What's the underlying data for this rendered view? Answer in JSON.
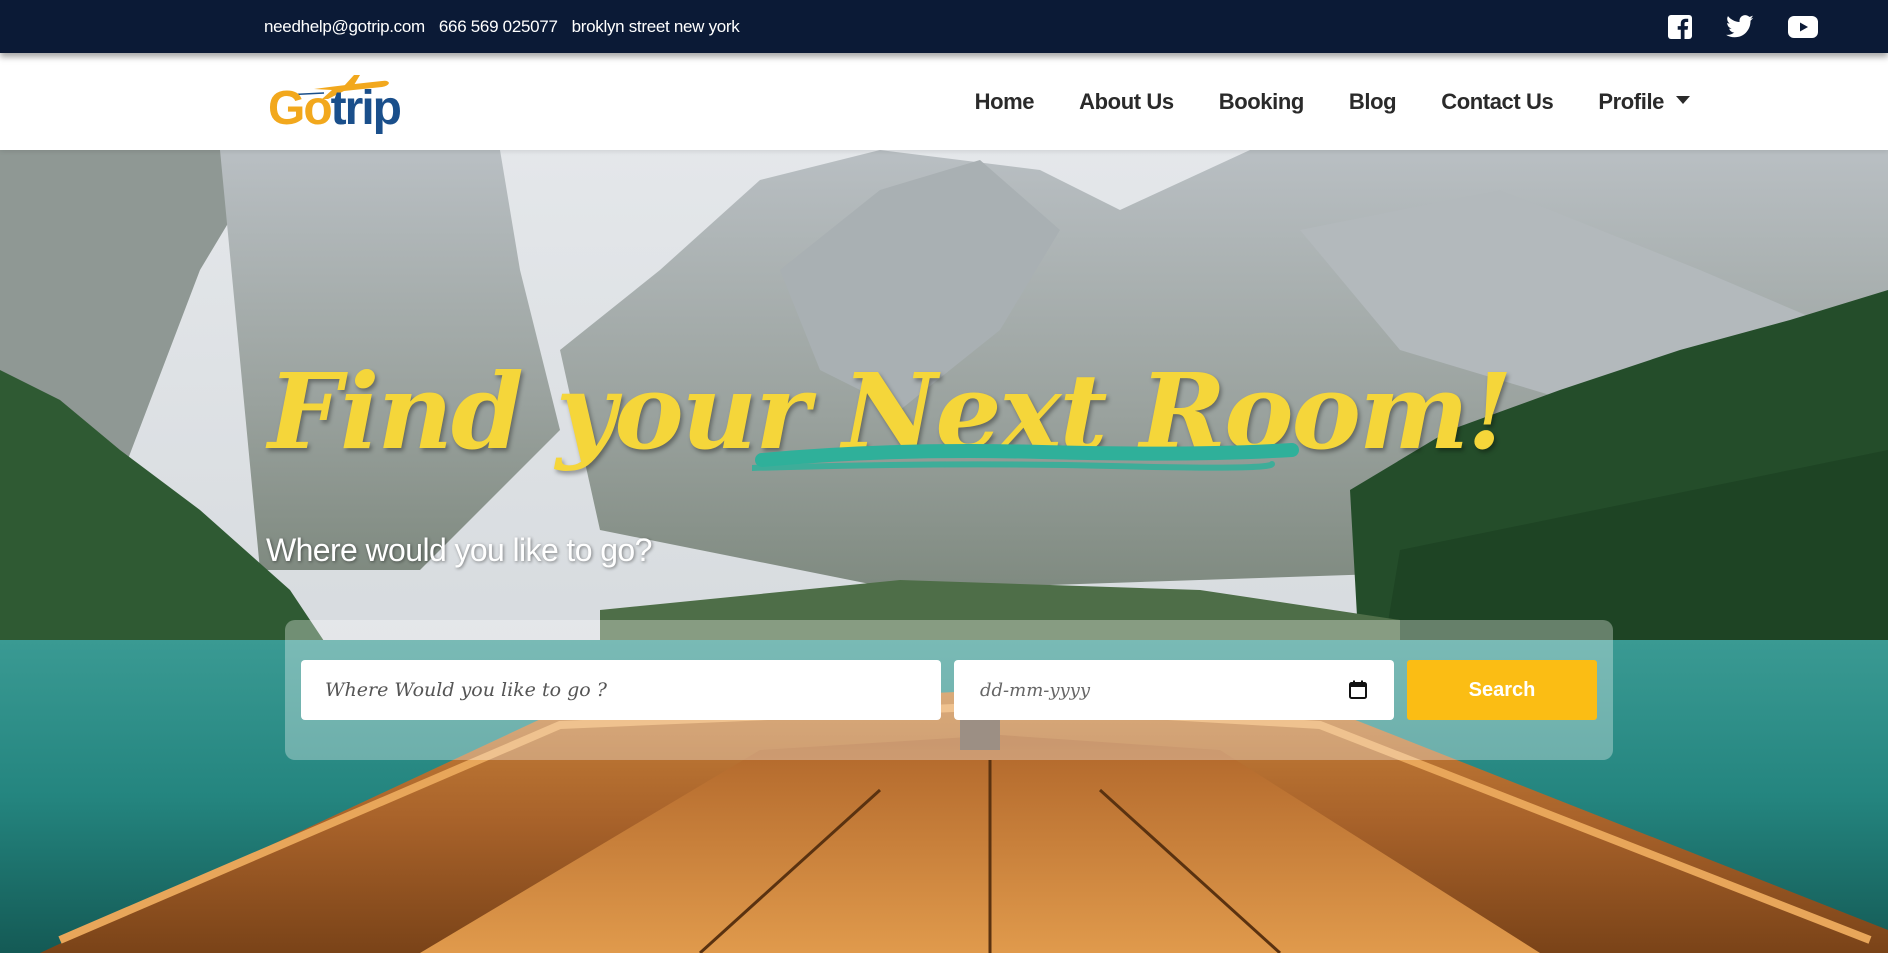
{
  "topbar": {
    "email": "needhelp@gotrip.com",
    "phone": "666 569 025077",
    "address": "broklyn street new york",
    "social": [
      "facebook-icon",
      "twitter-icon",
      "youtube-icon"
    ]
  },
  "logo": {
    "go": "Go",
    "trip": "trip"
  },
  "nav": {
    "home": "Home",
    "about": "About Us",
    "booking": "Booking",
    "blog": "Blog",
    "contact": "Contact Us",
    "profile": "Profile"
  },
  "hero": {
    "headline": "Find your Next Room!",
    "subheading": "Where would you like to go?"
  },
  "search": {
    "destination_placeholder": "Where Would you like to go ?",
    "date_placeholder": "dd-mm-yyyy",
    "button_label": "Search"
  },
  "colors": {
    "topbar_bg": "#0b1a36",
    "accent_yellow": "#fbbd14",
    "headline_yellow": "#f5d63a",
    "brush_teal": "#2fb09a",
    "logo_orange": "#f2a81d",
    "logo_blue": "#1a4f8b"
  }
}
